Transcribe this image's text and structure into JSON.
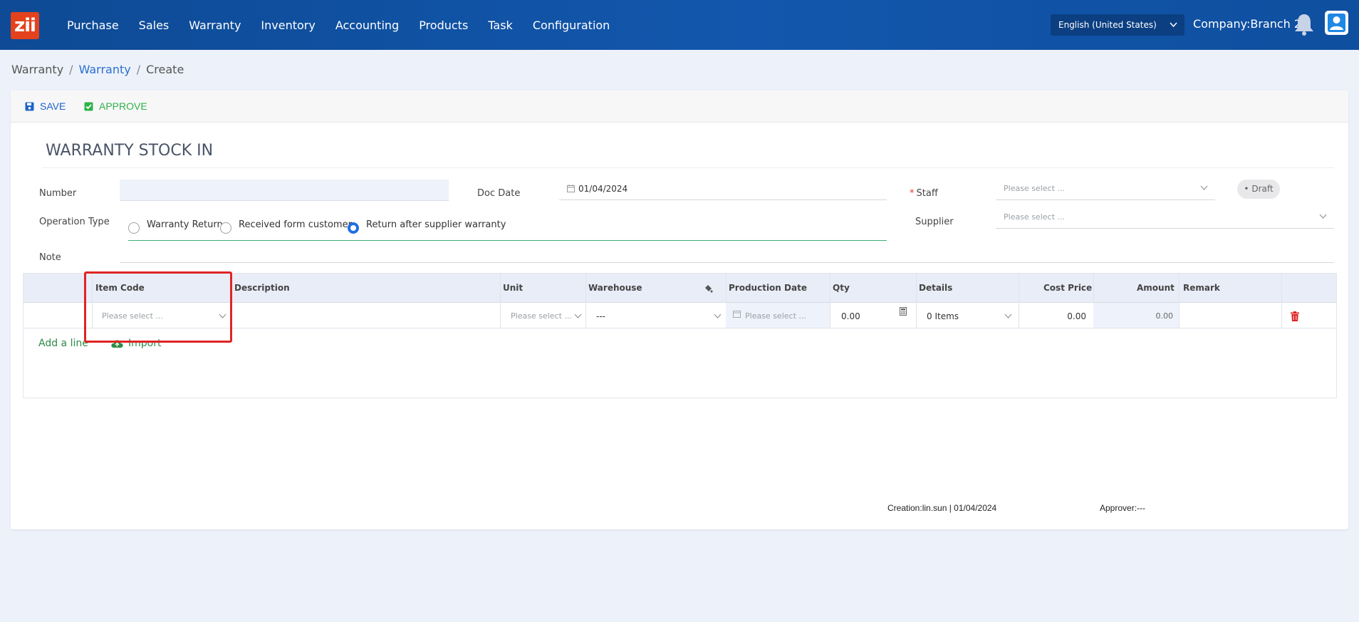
{
  "app": {
    "logo_text": "zii"
  },
  "nav": [
    "Purchase",
    "Sales",
    "Warranty",
    "Inventory",
    "Accounting",
    "Products",
    "Task",
    "Configuration"
  ],
  "header": {
    "language": "English (United States)",
    "company": "Company:Branch 2"
  },
  "breadcrumb": {
    "root": "Warranty",
    "parent": "Warranty",
    "current": "Create",
    "separator": "/"
  },
  "toolbar": {
    "save": "SAVE",
    "approve": "APPROVE"
  },
  "form": {
    "title": "WARRANTY STOCK IN",
    "number_label": "Number",
    "number_value": "",
    "doc_date_label": "Doc Date",
    "doc_date_value": "01/04/2024",
    "staff_label": "Staff",
    "staff_placeholder": "Please select ...",
    "status": "Draft",
    "operation_type_label": "Operation Type",
    "operation_types": [
      "Warranty Return",
      "Received form customer",
      "Return after supplier warranty"
    ],
    "operation_type_selected": "Return after supplier warranty",
    "supplier_label": "Supplier",
    "supplier_placeholder": "Please select ...",
    "note_label": "Note"
  },
  "table": {
    "columns": [
      "Item Code",
      "Description",
      "Unit",
      "Warehouse",
      "Production Date",
      "Qty",
      "Details",
      "Cost Price",
      "Amount",
      "Remark"
    ],
    "row": {
      "item_code": "Please select ...",
      "unit": "Please select ...",
      "warehouse": "---",
      "production_date": "Please select ...",
      "qty": "0.00",
      "details": "0 Items",
      "cost_price": "0.00",
      "amount": "0.00"
    },
    "add_line": "Add a line",
    "import": "Import"
  },
  "footer": {
    "creation": "Creation:lin.sun | 01/04/2024",
    "approver": "Approver:---"
  },
  "colors": {
    "nav_bg": "#0e4a95",
    "accent_blue": "#1f63c8",
    "approve_green": "#2fb24a",
    "highlight_red": "#e02424",
    "logo_orange": "#e4421c"
  }
}
